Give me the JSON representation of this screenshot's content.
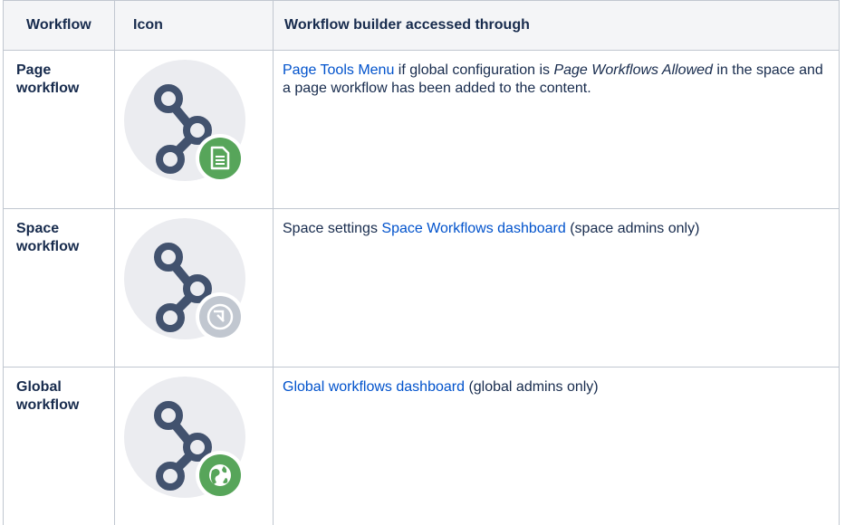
{
  "headers": {
    "workflow": "Workflow",
    "icon": "Icon",
    "builder": "Workflow builder accessed through"
  },
  "rows": [
    {
      "name_line1": "Page",
      "name_line2": "workflow",
      "icon": "page-workflow-icon",
      "badge_color": "#57a55a",
      "desc_link": "Page Tools Menu",
      "desc_text1": " if global configuration is ",
      "desc_italic": "Page Workflows Allowed",
      "desc_text2": " in the space and a page workflow has been added to the content."
    },
    {
      "name_line1": "Space",
      "name_line2": "workflow",
      "icon": "space-workflow-icon",
      "badge_color": "#c1c7d0",
      "desc_prefix": "Space settings ",
      "desc_link": "Space Workflows dashboard",
      "desc_suffix": " (space admins only)"
    },
    {
      "name_line1": "Global",
      "name_line2": "workflow",
      "icon": "global-workflow-icon",
      "badge_color": "#57a55a",
      "desc_link": "Global workflows dashboard",
      "desc_suffix": " (global admins only)"
    }
  ],
  "colors": {
    "link": "#0052cc",
    "text": "#172b4d",
    "header_bg": "#f4f5f7",
    "border": "#c1c7d0",
    "icon_circle": "#ebecf0",
    "node": "#42526e"
  }
}
